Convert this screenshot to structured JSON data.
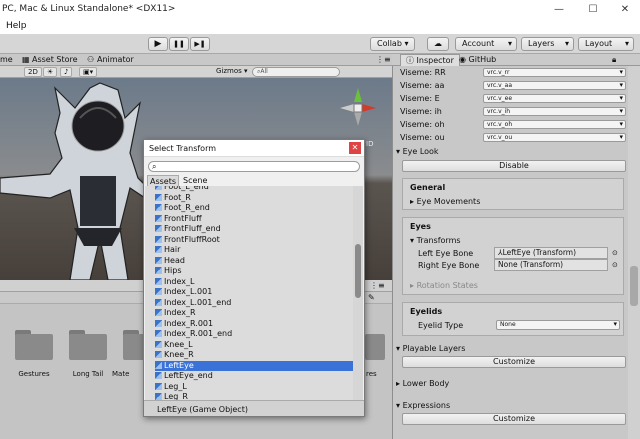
{
  "window": {
    "title": "PC, Mac & Linux Standalone* <DX11>",
    "min_icon": "—",
    "max_icon": "☐",
    "close_icon": "✕"
  },
  "menu": {
    "help": "Help"
  },
  "toolbar": {
    "play_icon": "▶",
    "pause_icon": "❚❚",
    "step_icon": "▶❚",
    "collab": "Collab ▾",
    "cloud_icon": "☁",
    "account": "Account",
    "layers": "Layers",
    "layout": "Layout"
  },
  "scene": {
    "tab_scene": "me",
    "tab_asset_store": "Asset Store",
    "tab_animator": "Animator",
    "mode_2d": "2D",
    "gizmos": "Gizmos ▾",
    "search_placeholder": "All",
    "persp_label": "ID"
  },
  "project": {
    "folders": [
      "Gestures",
      "Long Tail",
      "Mate",
      "",
      "res"
    ]
  },
  "inspector": {
    "tab_inspector": "Inspector",
    "tab_github": "GitHub",
    "visemes": [
      {
        "label": "Viseme: RR",
        "value": "vrc.v_rr"
      },
      {
        "label": "Viseme: aa",
        "value": "vrc.v_aa"
      },
      {
        "label": "Viseme: E",
        "value": "vrc.v_ee"
      },
      {
        "label": "Viseme: ih",
        "value": "vrc.v_ih"
      },
      {
        "label": "Viseme: oh",
        "value": "vrc.v_oh"
      },
      {
        "label": "Viseme: ou",
        "value": "vrc.v_ou"
      }
    ],
    "eye_look": "Eye Look",
    "disable": "Disable",
    "general": "General",
    "eye_movements": "Eye Movements",
    "eyes": "Eyes",
    "transforms": "Transforms",
    "left_eye_bone_label": "Left Eye Bone",
    "left_eye_bone_value": "LeftEye (Transform)",
    "right_eye_bone_label": "Right Eye Bone",
    "right_eye_bone_value": "None (Transform)",
    "rotation_states": "Rotation States",
    "eyelids": "Eyelids",
    "eyelid_type_label": "Eyelid Type",
    "eyelid_type_value": "None",
    "playable_layers": "Playable Layers",
    "customize": "Customize",
    "lower_body": "Lower Body",
    "expressions": "Expressions"
  },
  "dialog": {
    "title": "Select Transform",
    "close_icon": "✕",
    "search_icon": "⌕",
    "tab_assets": "Assets",
    "tab_scene": "Scene",
    "items": [
      "Foot_L_end",
      "Foot_R",
      "Foot_R_end",
      "FrontFluff",
      "FrontFluff_end",
      "FrontFluffRoot",
      "Hair",
      "Head",
      "Hips",
      "Index_L",
      "Index_L.001",
      "Index_L.001_end",
      "Index_R",
      "Index_R.001",
      "Index_R.001_end",
      "Knee_L",
      "Knee_R",
      "LeftEye",
      "LeftEye_end",
      "Leg_L",
      "Leg_R"
    ],
    "selected_index": 17,
    "footer": "LeftEye (Game Object)",
    "accent": "#3a72d7"
  }
}
